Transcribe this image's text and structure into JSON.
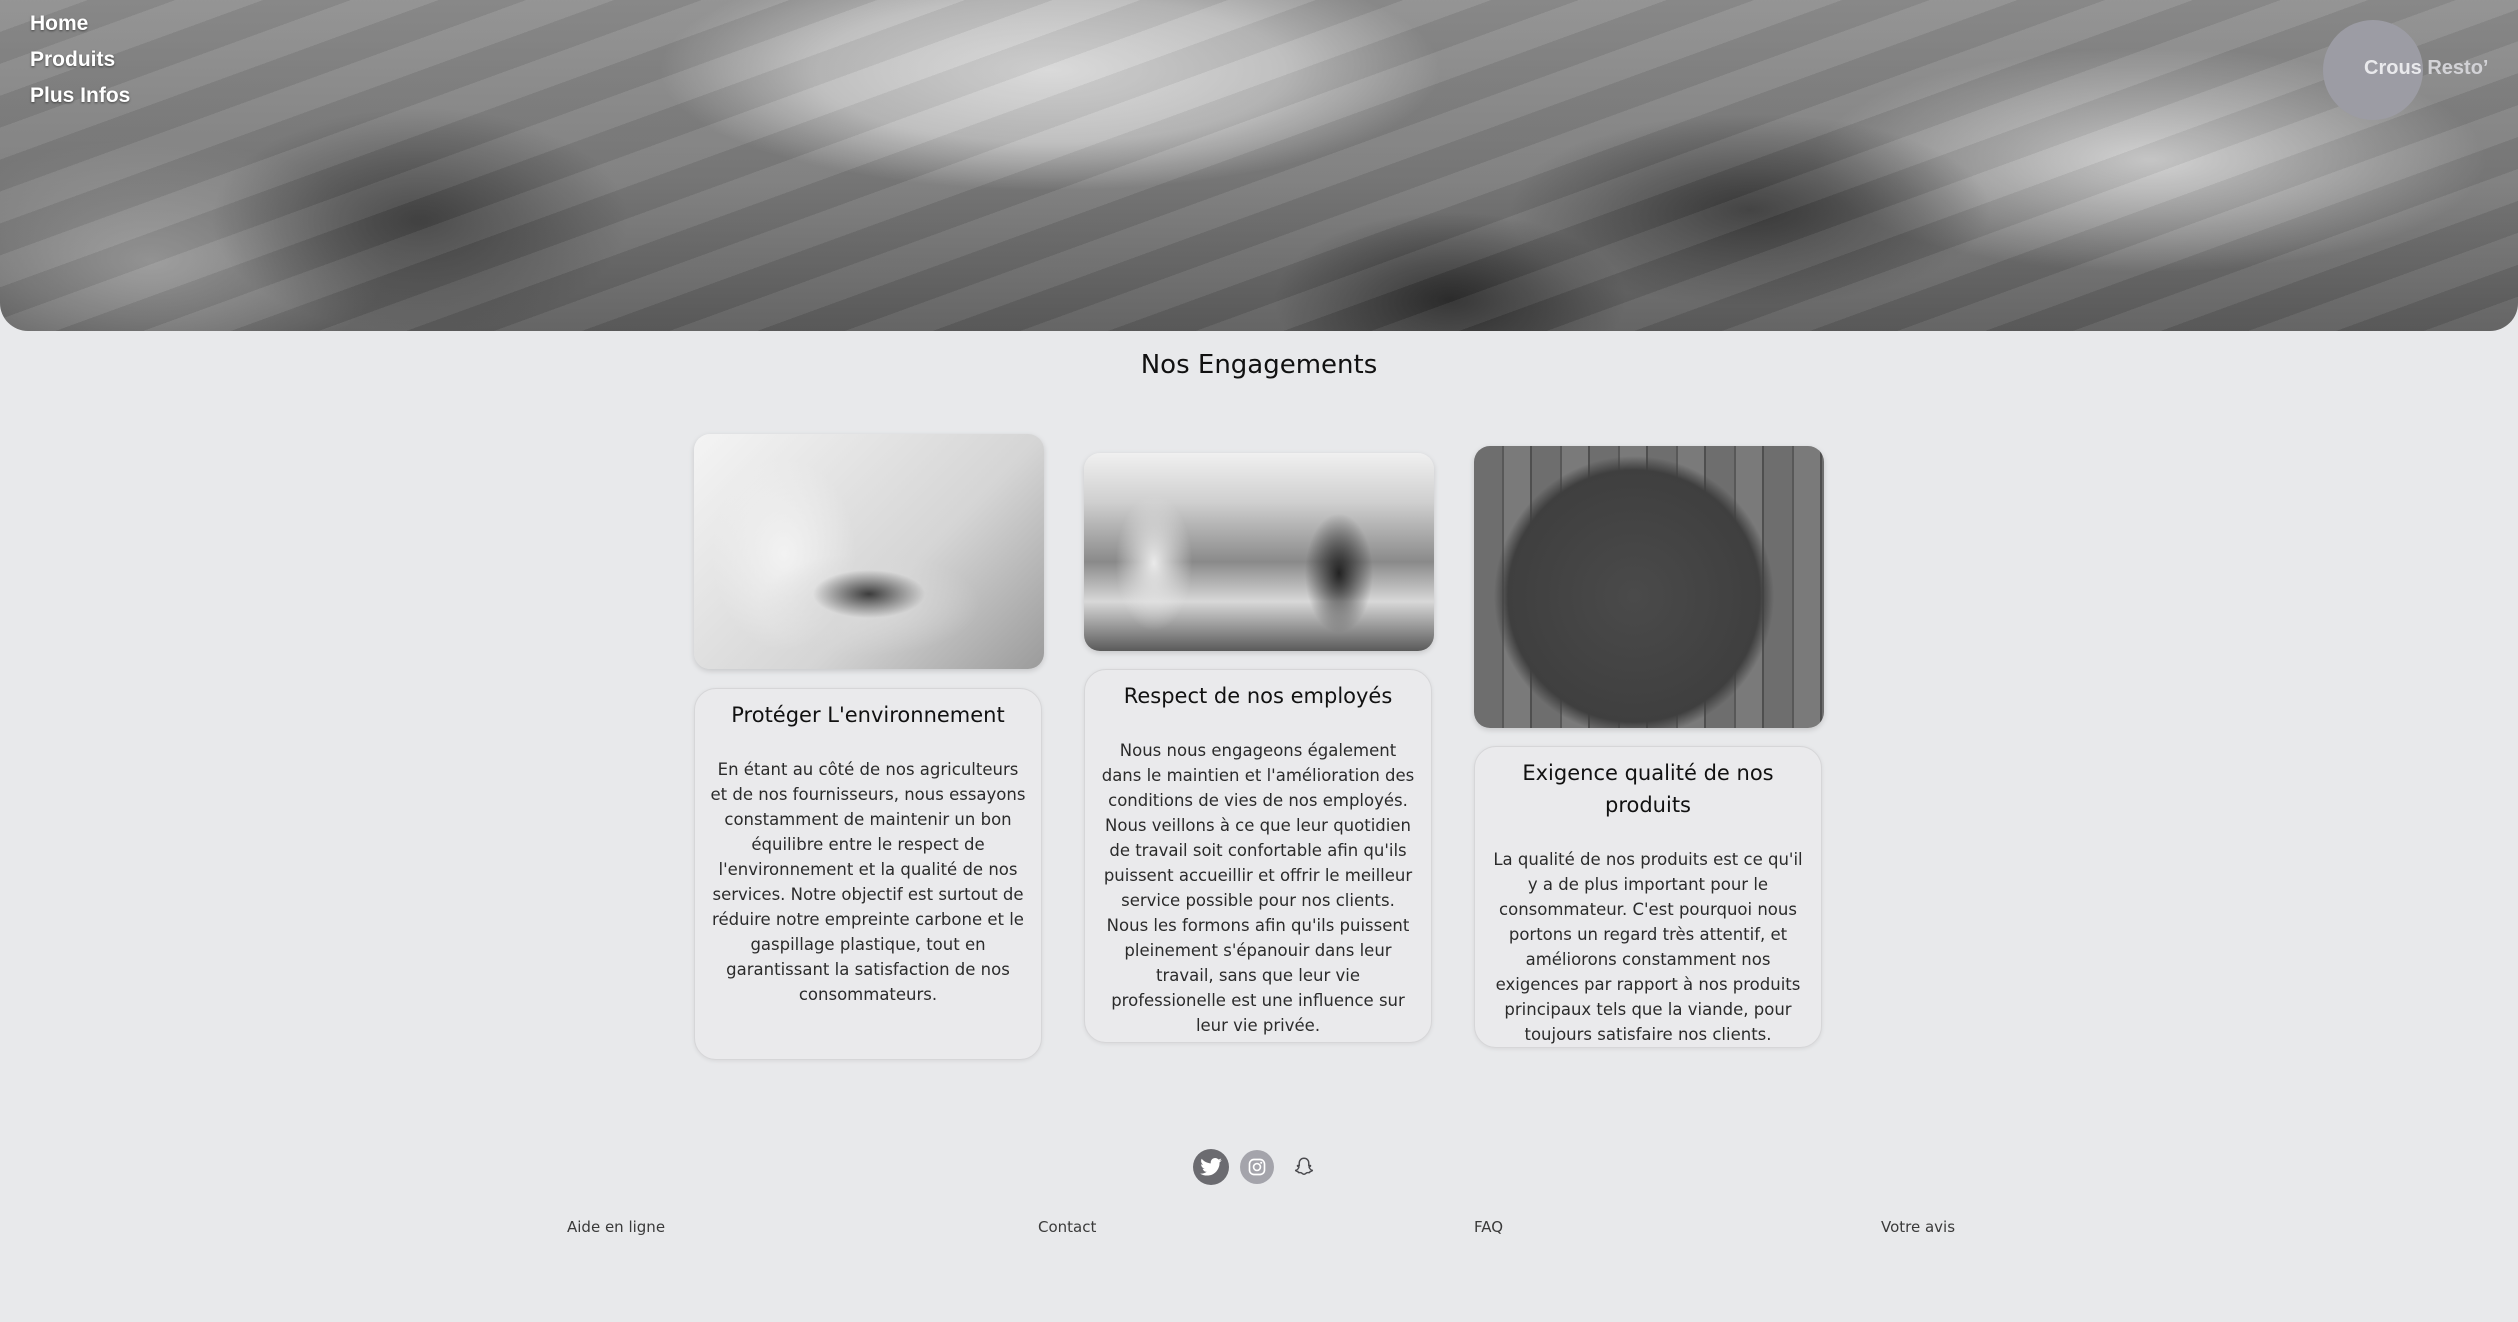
{
  "nav": {
    "items": [
      "Home",
      "Produits",
      "Plus Infos"
    ]
  },
  "logo": {
    "text_main": "Crous",
    "text_faded": "Resto’"
  },
  "section": {
    "title": "Nos Engagements"
  },
  "cards": [
    {
      "title": "Protéger L'environnement",
      "text": "En étant au côté de nos agriculteurs et de nos fournisseurs, nous essayons constamment de maintenir un bon équilibre entre le respect de l'environnement et la qualité de nos services. Notre objectif est surtout de réduire notre empreinte carbone et le gaspillage plastique, tout en garantissant la satisfaction de nos consommateurs."
    },
    {
      "title": "Respect de nos employés",
      "text": "Nous nous engageons également dans le maintien et l'amélioration des conditions de vies de nos employés. Nous veillons à ce que leur quotidien de travail soit confortable afin qu'ils puissent accueillir et offrir le meilleur service possible pour nos clients. Nous les formons afin qu'ils puissent pleinement s'épanouir dans leur travail, sans que leur vie professionelle est une influence sur leur vie privée."
    },
    {
      "title": "Exigence qualité de nos produits",
      "text": "La qualité de nos produits est ce qu'il y a de plus important pour le consommateur. C'est pourquoi nous portons un regard très attentif, et améliorons constamment nos exigences par rapport à nos produits principaux tels que la viande, pour toujours satisfaire nos clients."
    }
  ],
  "social": {
    "icons": [
      "twitter-icon",
      "instagram-icon",
      "snapchat-icon"
    ]
  },
  "footer": {
    "links": [
      "Aide en ligne",
      "Contact",
      "FAQ",
      "Votre avis"
    ]
  },
  "colors": {
    "background": "#e8e9eb",
    "logo_circle": "#9c9ca4",
    "twitter_circle": "#6b6b70",
    "instagram_circle": "#a4a4ab"
  }
}
